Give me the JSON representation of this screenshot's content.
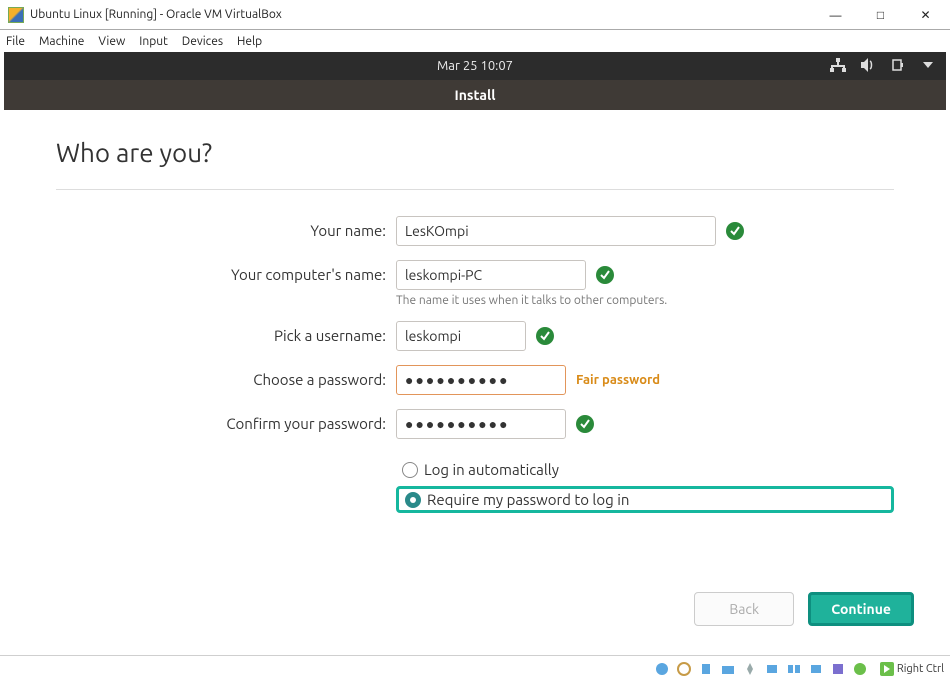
{
  "window": {
    "title": "Ubuntu Linux [Running] - Oracle VM VirtualBox",
    "menus": [
      "File",
      "Machine",
      "View",
      "Input",
      "Devices",
      "Help"
    ]
  },
  "guest": {
    "clock": "Mar 25  10:07",
    "subheader": "Install"
  },
  "installer": {
    "heading": "Who are you?",
    "labels": {
      "name": "Your name:",
      "computer": "Your computer's name:",
      "username": "Pick a username:",
      "password": "Choose a password:",
      "confirm": "Confirm your password:"
    },
    "values": {
      "name": "LesKOmpi",
      "computer": "leskompi-PC",
      "username": "leskompi",
      "password": "●●●●●●●●●●",
      "confirm": "●●●●●●●●●●"
    },
    "hints": {
      "computer": "The name it uses when it talks to other computers.",
      "password_strength": "Fair password"
    },
    "login_options": {
      "auto": "Log in automatically",
      "require": "Require my password to log in",
      "selected": "require"
    },
    "buttons": {
      "back": "Back",
      "continue": "Continue"
    }
  },
  "statusbar": {
    "hostkey": "Right Ctrl"
  }
}
